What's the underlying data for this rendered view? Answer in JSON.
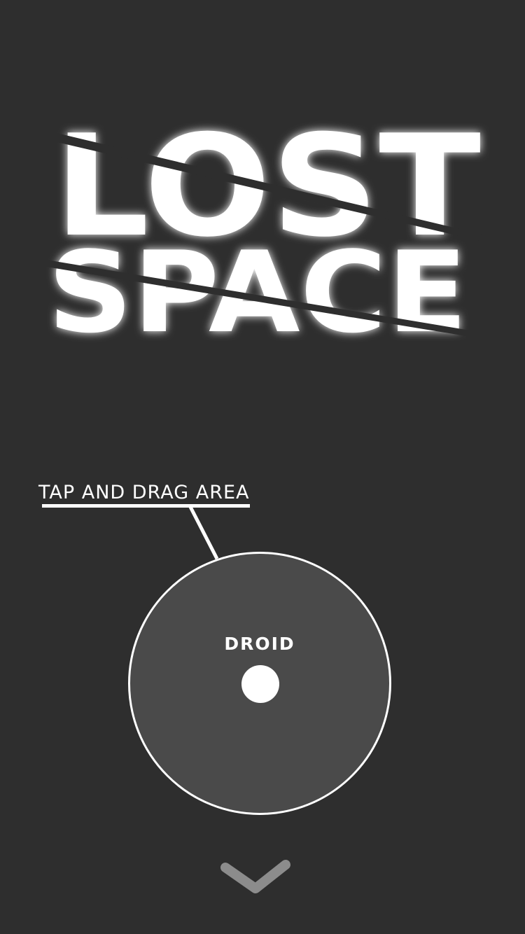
{
  "logo": {
    "line1": "LOST",
    "line2": "SPACE"
  },
  "hint": {
    "label": "TAP AND DRAG AREA"
  },
  "drag_area": {
    "character_label": "DROID"
  },
  "icons": {
    "next": "chevron-down-icon"
  },
  "colors": {
    "background": "#2e2e2e",
    "circle_fill": "#4a4a4a",
    "foreground": "#ffffff",
    "chevron": "#8c8c8c"
  }
}
